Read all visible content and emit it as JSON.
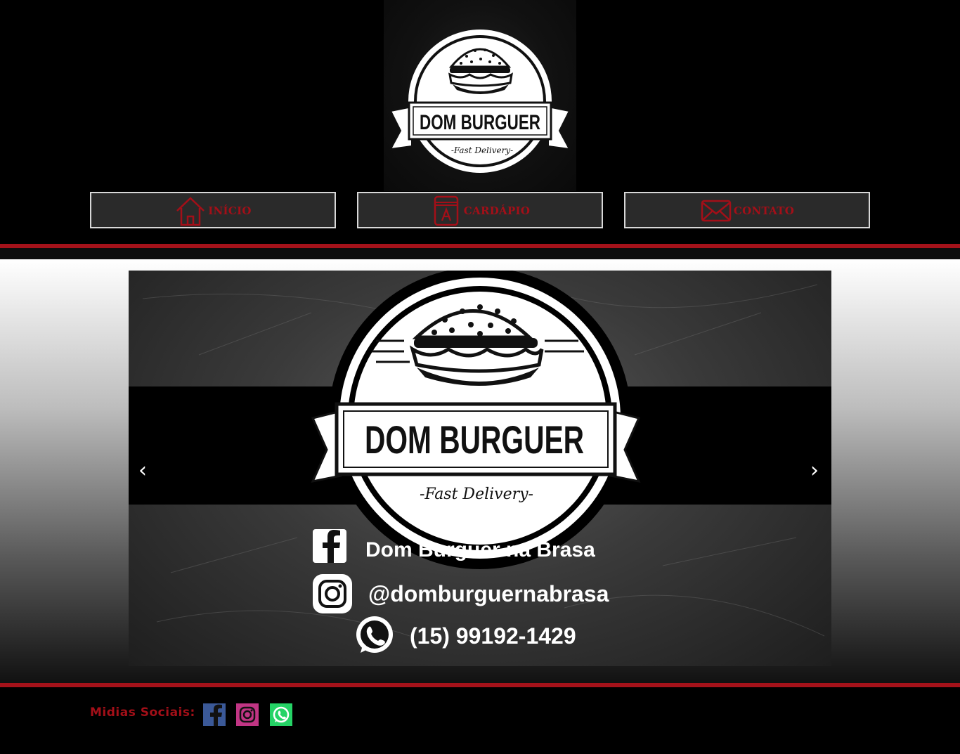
{
  "brand": {
    "logo_title": "DOM BURGUER",
    "logo_tagline": "-Fast Delivery-"
  },
  "nav": {
    "items": [
      {
        "label": "INÍCIO",
        "icon": "home-icon"
      },
      {
        "label": "CARDÁPIO",
        "icon": "menu-book-icon"
      },
      {
        "label": "CONTATO",
        "icon": "envelope-icon"
      }
    ]
  },
  "carousel": {
    "slide": {
      "title": "DOM BURGUER",
      "tagline": "-Fast Delivery-",
      "facebook_text": "Dom Burguer na Brasa",
      "instagram_text": "@domburguernabrasa",
      "whatsapp_text": "(15) 99192-1429"
    },
    "prev_label": "‹",
    "next_label": "›"
  },
  "footer": {
    "social_label": "Midias Sociais:",
    "socials": [
      "facebook-icon",
      "instagram-icon",
      "whatsapp-icon"
    ]
  },
  "colors": {
    "accent_red": "#a4121a",
    "label_red": "#a30f18",
    "background": "#000000",
    "nav_button_bg": "#2a2a2a"
  }
}
